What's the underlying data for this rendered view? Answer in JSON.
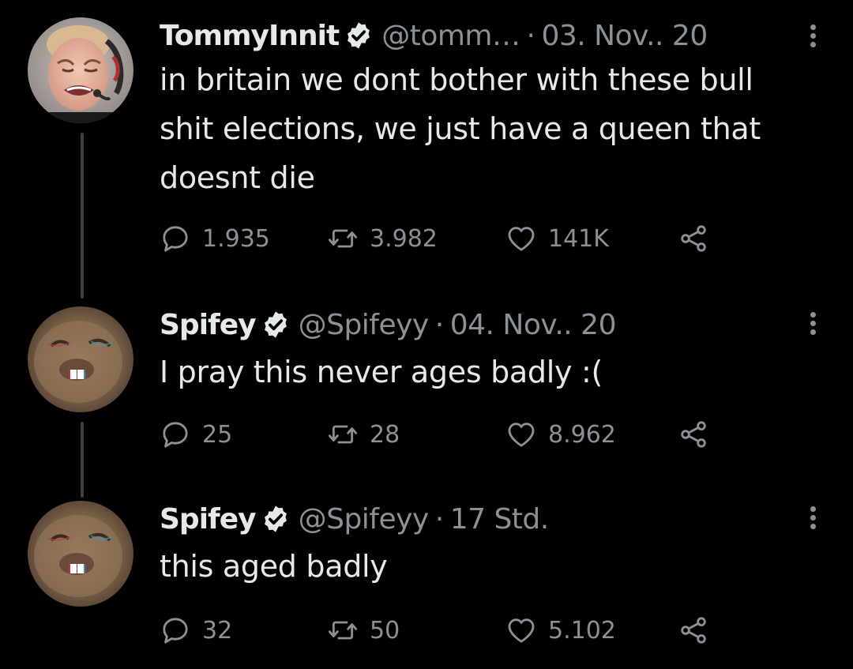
{
  "thread": [
    {
      "author": "TommyInnit",
      "handle": "@tomm…",
      "separator": "·",
      "date": "03. Nov.. 20",
      "text": "in britain we dont bother with these bull shit elections, we just have a queen that doesnt die",
      "replies": "1.935",
      "retweets": "3.982",
      "likes": "141K"
    },
    {
      "author": "Spifey",
      "handle": "@Spifeyy",
      "separator": "·",
      "date": "04. Nov.. 20",
      "text": "I pray this never ages badly :(",
      "replies": "25",
      "retweets": "28",
      "likes": "8.962"
    },
    {
      "author": "Spifey",
      "handle": "@Spifeyy",
      "separator": "·",
      "date": "17 Std.",
      "text": "this aged badly",
      "replies": "32",
      "retweets": "50",
      "likes": "5.102"
    }
  ],
  "icons": {
    "verified": "verified-badge-icon",
    "reply": "reply-icon",
    "retweet": "retweet-icon",
    "like": "heart-icon",
    "share": "share-icon",
    "more": "more-vertical-icon"
  },
  "colors": {
    "background": "#000000",
    "text": "#e6e9ea",
    "secondary": "#8b9196",
    "thread_line": "#3d4145"
  }
}
